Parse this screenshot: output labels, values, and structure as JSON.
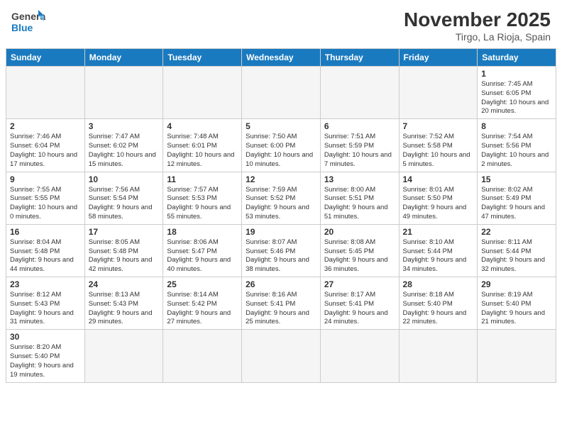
{
  "header": {
    "logo_general": "General",
    "logo_blue": "Blue",
    "month_title": "November 2025",
    "location": "Tirgo, La Rioja, Spain"
  },
  "days_of_week": [
    "Sunday",
    "Monday",
    "Tuesday",
    "Wednesday",
    "Thursday",
    "Friday",
    "Saturday"
  ],
  "weeks": [
    [
      {
        "day": "",
        "info": ""
      },
      {
        "day": "",
        "info": ""
      },
      {
        "day": "",
        "info": ""
      },
      {
        "day": "",
        "info": ""
      },
      {
        "day": "",
        "info": ""
      },
      {
        "day": "",
        "info": ""
      },
      {
        "day": "1",
        "info": "Sunrise: 7:45 AM\nSunset: 6:05 PM\nDaylight: 10 hours\nand 20 minutes."
      }
    ],
    [
      {
        "day": "2",
        "info": "Sunrise: 7:46 AM\nSunset: 6:04 PM\nDaylight: 10 hours\nand 17 minutes."
      },
      {
        "day": "3",
        "info": "Sunrise: 7:47 AM\nSunset: 6:02 PM\nDaylight: 10 hours\nand 15 minutes."
      },
      {
        "day": "4",
        "info": "Sunrise: 7:48 AM\nSunset: 6:01 PM\nDaylight: 10 hours\nand 12 minutes."
      },
      {
        "day": "5",
        "info": "Sunrise: 7:50 AM\nSunset: 6:00 PM\nDaylight: 10 hours\nand 10 minutes."
      },
      {
        "day": "6",
        "info": "Sunrise: 7:51 AM\nSunset: 5:59 PM\nDaylight: 10 hours\nand 7 minutes."
      },
      {
        "day": "7",
        "info": "Sunrise: 7:52 AM\nSunset: 5:58 PM\nDaylight: 10 hours\nand 5 minutes."
      },
      {
        "day": "8",
        "info": "Sunrise: 7:54 AM\nSunset: 5:56 PM\nDaylight: 10 hours\nand 2 minutes."
      }
    ],
    [
      {
        "day": "9",
        "info": "Sunrise: 7:55 AM\nSunset: 5:55 PM\nDaylight: 10 hours\nand 0 minutes."
      },
      {
        "day": "10",
        "info": "Sunrise: 7:56 AM\nSunset: 5:54 PM\nDaylight: 9 hours\nand 58 minutes."
      },
      {
        "day": "11",
        "info": "Sunrise: 7:57 AM\nSunset: 5:53 PM\nDaylight: 9 hours\nand 55 minutes."
      },
      {
        "day": "12",
        "info": "Sunrise: 7:59 AM\nSunset: 5:52 PM\nDaylight: 9 hours\nand 53 minutes."
      },
      {
        "day": "13",
        "info": "Sunrise: 8:00 AM\nSunset: 5:51 PM\nDaylight: 9 hours\nand 51 minutes."
      },
      {
        "day": "14",
        "info": "Sunrise: 8:01 AM\nSunset: 5:50 PM\nDaylight: 9 hours\nand 49 minutes."
      },
      {
        "day": "15",
        "info": "Sunrise: 8:02 AM\nSunset: 5:49 PM\nDaylight: 9 hours\nand 47 minutes."
      }
    ],
    [
      {
        "day": "16",
        "info": "Sunrise: 8:04 AM\nSunset: 5:48 PM\nDaylight: 9 hours\nand 44 minutes."
      },
      {
        "day": "17",
        "info": "Sunrise: 8:05 AM\nSunset: 5:48 PM\nDaylight: 9 hours\nand 42 minutes."
      },
      {
        "day": "18",
        "info": "Sunrise: 8:06 AM\nSunset: 5:47 PM\nDaylight: 9 hours\nand 40 minutes."
      },
      {
        "day": "19",
        "info": "Sunrise: 8:07 AM\nSunset: 5:46 PM\nDaylight: 9 hours\nand 38 minutes."
      },
      {
        "day": "20",
        "info": "Sunrise: 8:08 AM\nSunset: 5:45 PM\nDaylight: 9 hours\nand 36 minutes."
      },
      {
        "day": "21",
        "info": "Sunrise: 8:10 AM\nSunset: 5:44 PM\nDaylight: 9 hours\nand 34 minutes."
      },
      {
        "day": "22",
        "info": "Sunrise: 8:11 AM\nSunset: 5:44 PM\nDaylight: 9 hours\nand 32 minutes."
      }
    ],
    [
      {
        "day": "23",
        "info": "Sunrise: 8:12 AM\nSunset: 5:43 PM\nDaylight: 9 hours\nand 31 minutes."
      },
      {
        "day": "24",
        "info": "Sunrise: 8:13 AM\nSunset: 5:43 PM\nDaylight: 9 hours\nand 29 minutes."
      },
      {
        "day": "25",
        "info": "Sunrise: 8:14 AM\nSunset: 5:42 PM\nDaylight: 9 hours\nand 27 minutes."
      },
      {
        "day": "26",
        "info": "Sunrise: 8:16 AM\nSunset: 5:41 PM\nDaylight: 9 hours\nand 25 minutes."
      },
      {
        "day": "27",
        "info": "Sunrise: 8:17 AM\nSunset: 5:41 PM\nDaylight: 9 hours\nand 24 minutes."
      },
      {
        "day": "28",
        "info": "Sunrise: 8:18 AM\nSunset: 5:40 PM\nDaylight: 9 hours\nand 22 minutes."
      },
      {
        "day": "29",
        "info": "Sunrise: 8:19 AM\nSunset: 5:40 PM\nDaylight: 9 hours\nand 21 minutes."
      }
    ],
    [
      {
        "day": "30",
        "info": "Sunrise: 8:20 AM\nSunset: 5:40 PM\nDaylight: 9 hours\nand 19 minutes."
      },
      {
        "day": "",
        "info": ""
      },
      {
        "day": "",
        "info": ""
      },
      {
        "day": "",
        "info": ""
      },
      {
        "day": "",
        "info": ""
      },
      {
        "day": "",
        "info": ""
      },
      {
        "day": "",
        "info": ""
      }
    ]
  ]
}
